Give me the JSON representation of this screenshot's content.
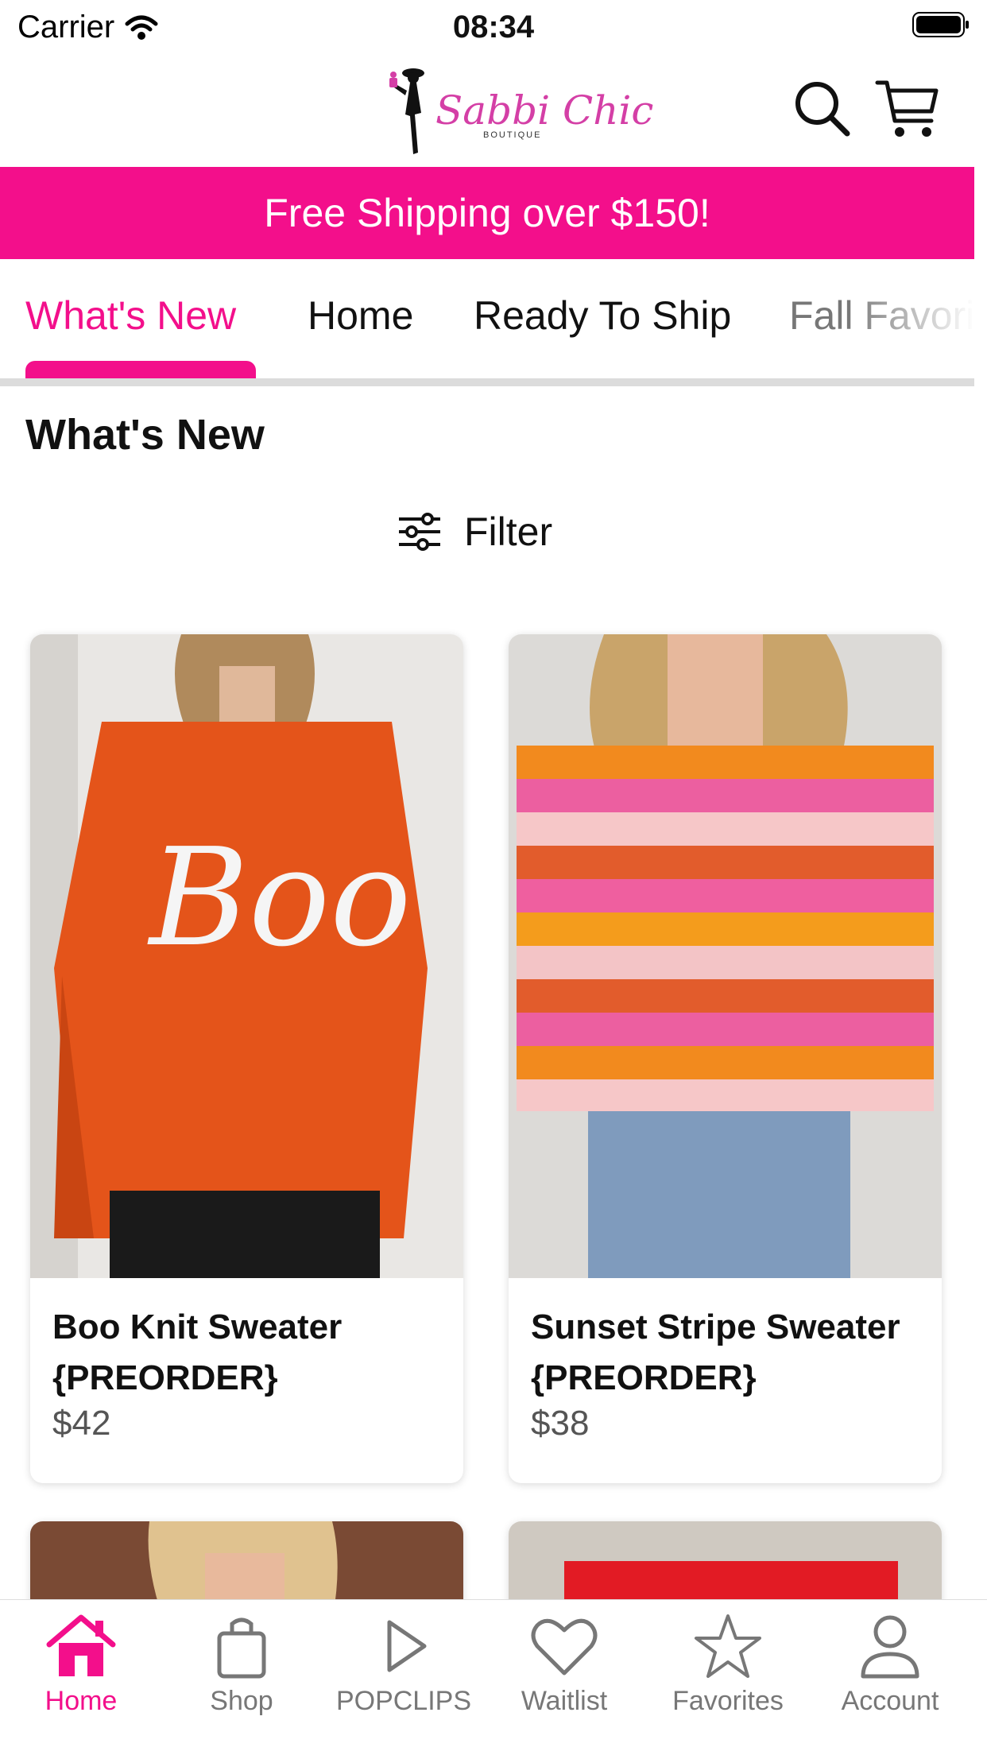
{
  "status": {
    "carrier": "Carrier",
    "time": "08:34"
  },
  "header": {
    "brand": "Sabbi Chic",
    "brand_sub": "BOUTIQUE"
  },
  "promo": {
    "text": "Free Shipping over $150!"
  },
  "tabs": [
    {
      "label": "What's New",
      "active": true
    },
    {
      "label": "Home"
    },
    {
      "label": "Ready To Ship"
    },
    {
      "label": "Fall Favorites"
    }
  ],
  "section": {
    "title": "What's New"
  },
  "filter": {
    "label": "Filter"
  },
  "products": [
    {
      "name": "Boo Knit Sweater {PREORDER}",
      "price": "$42",
      "image_text": "Boo"
    },
    {
      "name": "Sunset Stripe Sweater {PREORDER}",
      "price": "$38"
    }
  ],
  "tabbar": [
    {
      "label": "Home",
      "icon": "home-icon",
      "active": true
    },
    {
      "label": "Shop",
      "icon": "bag-icon"
    },
    {
      "label": "POPCLIPS",
      "icon": "play-icon"
    },
    {
      "label": "Waitlist",
      "icon": "heart-icon"
    },
    {
      "label": "Favorites",
      "icon": "star-icon"
    },
    {
      "label": "Account",
      "icon": "person-icon"
    }
  ],
  "colors": {
    "accent": "#f30f8b",
    "logo": "#d43fa6"
  }
}
